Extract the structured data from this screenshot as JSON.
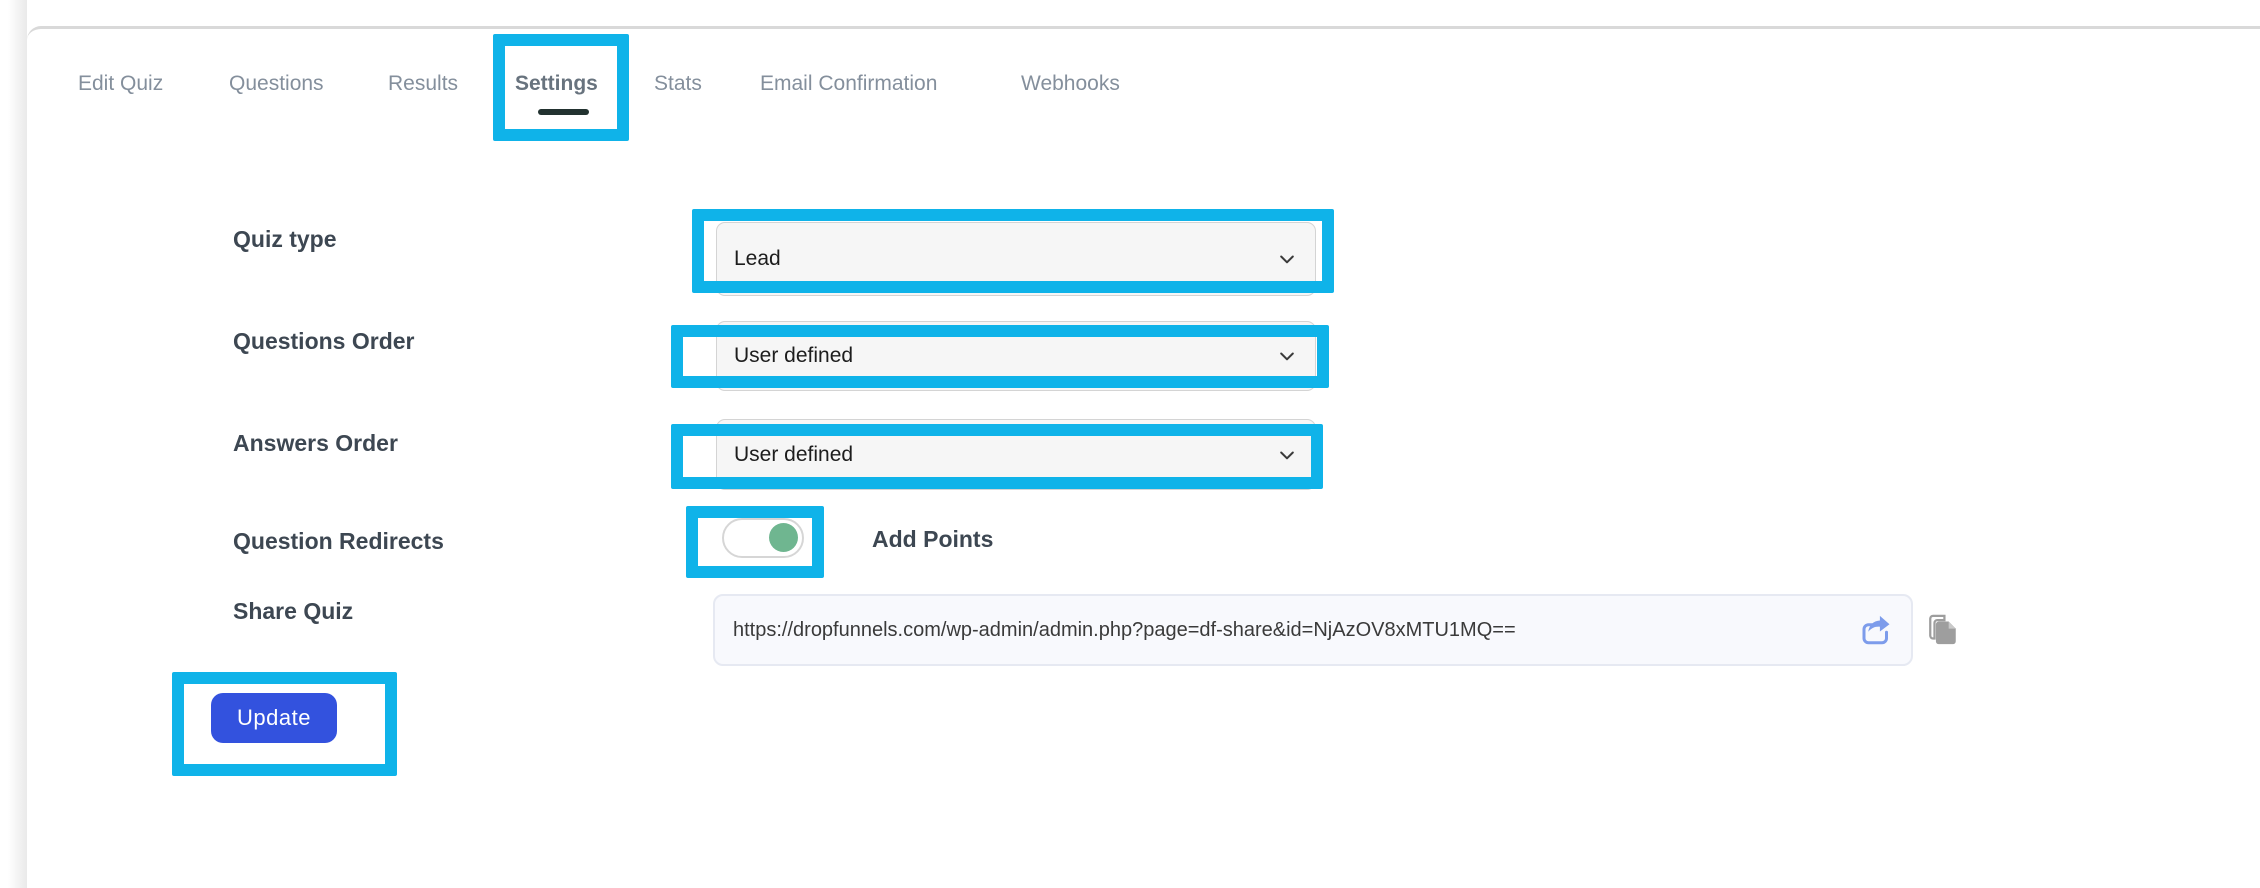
{
  "tabs": {
    "items": [
      {
        "label": "Edit Quiz",
        "active": false
      },
      {
        "label": "Questions",
        "active": false
      },
      {
        "label": "Results",
        "active": false
      },
      {
        "label": "Settings",
        "active": true
      },
      {
        "label": "Stats",
        "active": false
      },
      {
        "label": "Email Confirmation",
        "active": false
      },
      {
        "label": "Webhooks",
        "active": false
      }
    ]
  },
  "form": {
    "quiz_type": {
      "label": "Quiz type",
      "selected": "Lead"
    },
    "questions_order": {
      "label": "Questions Order",
      "selected": "User defined"
    },
    "answers_order": {
      "label": "Answers Order",
      "selected": "User defined"
    },
    "question_redirects": {
      "label": "Question Redirects",
      "toggle_state": "on",
      "companion_label": "Add Points"
    },
    "share_quiz": {
      "label": "Share Quiz",
      "url": "https://dropfunnels.com/wp-admin/admin.php?page=df-share&id=NjAzOV8xMTU1MQ=="
    }
  },
  "buttons": {
    "update": "Update"
  },
  "icons": {
    "chevron": "chevron-down-icon",
    "share": "share-icon",
    "copy": "copy-icon"
  },
  "colors": {
    "annotation_highlight": "#0fb3e9",
    "primary_button": "#3352de",
    "toggle_knob_on": "#6fb690",
    "active_tab_underline": "#223230",
    "share_icon_blue": "#7d9ceb",
    "copy_icon_gray": "#9e9e9e",
    "select_background": "#f6f6f6",
    "input_background": "#f8f9fd"
  }
}
